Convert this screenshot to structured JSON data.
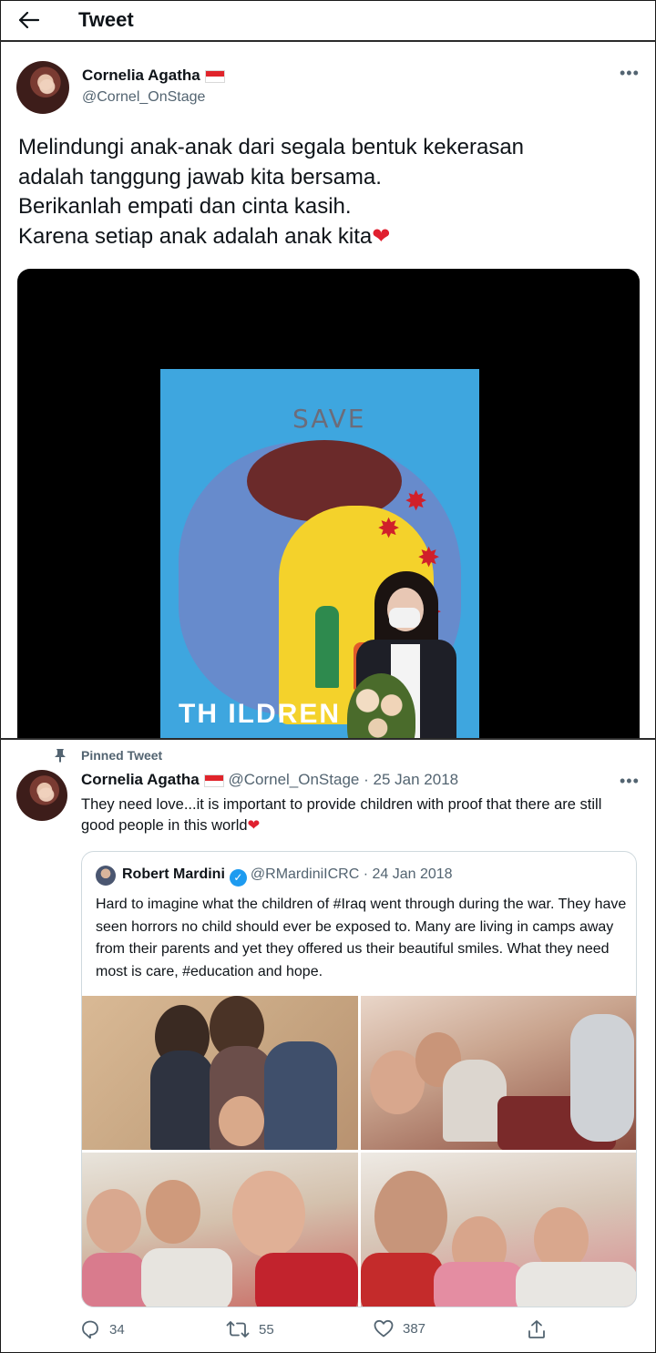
{
  "header": {
    "title": "Tweet"
  },
  "main_tweet": {
    "author_name": "Cornelia Agatha",
    "author_handle": "@Cornel_OnStage",
    "text_lines": [
      "Melindungi anak-anak dari segala bentuk kekerasan",
      "adalah tanggung jawab kita bersama.",
      "Berikanlah empati dan cinta kasih.",
      "Karena setiap anak adalah anak kita"
    ],
    "text_emoji": "❤"
  },
  "poster": {
    "top_word": "SAVE",
    "bottom_word": "TH  ILDREN"
  },
  "pinned_tweet": {
    "pinned_label": "Pinned Tweet",
    "author_name": "Cornelia Agatha",
    "author_handle": "@Cornel_OnStage",
    "separator": "·",
    "date": "25 Jan 2018",
    "text": "They need love...it is important to provide children with proof that there are still good people in this world",
    "text_emoji": "❤"
  },
  "quoted_tweet": {
    "author_name": "Robert Mardini",
    "verified_mark": "✓",
    "author_handle": "@RMardiniICRC",
    "separator": "·",
    "date": "24 Jan 2018",
    "text": "Hard to imagine what the children of #Iraq went through during the war. They have seen horrors no child should ever be exposed to. Many are living in camps away from their parents and yet they offered us their beautiful smiles. What they need most is care, #education and hope."
  },
  "actions": {
    "reply_count": "34",
    "retweet_count": "55",
    "like_count": "387"
  },
  "icons": [
    "back-arrow-icon",
    "more-icon",
    "pin-icon",
    "verified-icon",
    "reply-icon",
    "retweet-icon",
    "like-icon",
    "share-icon"
  ],
  "colors": {
    "heart": "#e0202f",
    "verified": "#1d9bf0",
    "secondary_text": "#536471",
    "flag_red": "#e0242b"
  }
}
